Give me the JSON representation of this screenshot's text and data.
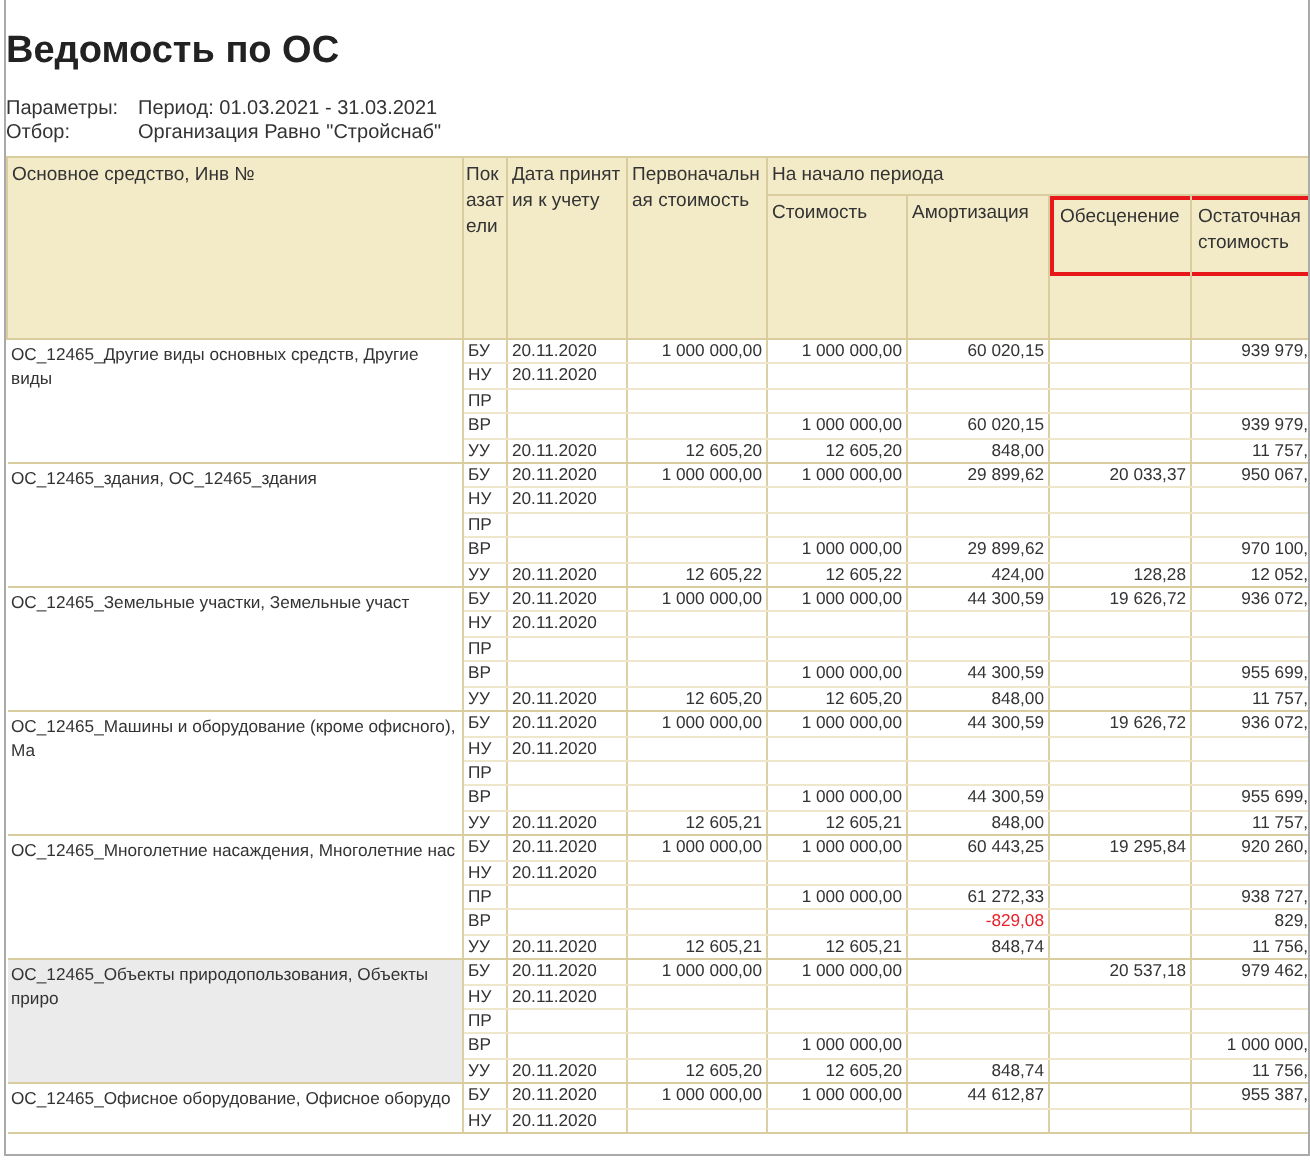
{
  "title": "Ведомость по ОС",
  "parameters": [
    {
      "label": "Параметры:",
      "value": "Период: 01.03.2021 - 31.03.2021"
    },
    {
      "label": "Отбор:",
      "value": "Организация Равно \"Стройснаб\""
    }
  ],
  "table": {
    "columns": [
      {
        "label": "Основное средство, Инв №"
      },
      {
        "label": "Показатели"
      },
      {
        "label": "Дата принятия к учету"
      },
      {
        "label": "Первоначальная стоимость"
      }
    ],
    "column_group": {
      "label": "На начало периода",
      "columns": [
        {
          "label": "Стоимость",
          "highlighted": false
        },
        {
          "label": "Амортизация",
          "highlighted": false
        },
        {
          "label": "Обесценение",
          "highlighted": true
        },
        {
          "label": "Остаточная стоимость",
          "highlighted": true
        }
      ]
    },
    "groups": [
      {
        "asset": "ОС_12465_Другие виды основных средств, Другие виды",
        "selected": false,
        "rows": [
          {
            "indicator": "БУ",
            "date": "20.11.2020",
            "initial": "1 000 000,00",
            "cost": "1 000 000,00",
            "amortization": "60 020,15",
            "negative": false,
            "residual": "939 979,"
          },
          {
            "indicator": "НУ",
            "date": "20.11.2020"
          },
          {
            "indicator": "ПР"
          },
          {
            "indicator": "ВР",
            "cost": "1 000 000,00",
            "amortization": "60 020,15",
            "negative": false,
            "residual": "939 979,"
          },
          {
            "indicator": "УУ",
            "date": "20.11.2020",
            "initial": "12 605,20",
            "cost": "12 605,20",
            "amortization": "848,00",
            "negative": false,
            "residual": "11 757,"
          }
        ]
      },
      {
        "asset": "ОС_12465_здания, ОС_12465_здания",
        "selected": false,
        "rows": [
          {
            "indicator": "БУ",
            "date": "20.11.2020",
            "initial": "1 000 000,00",
            "cost": "1 000 000,00",
            "amortization": "29 899,62",
            "negative": false,
            "impairment": "20 033,37",
            "residual": "950 067,"
          },
          {
            "indicator": "НУ",
            "date": "20.11.2020"
          },
          {
            "indicator": "ПР"
          },
          {
            "indicator": "ВР",
            "cost": "1 000 000,00",
            "amortization": "29 899,62",
            "negative": false,
            "residual": "970 100,"
          },
          {
            "indicator": "УУ",
            "date": "20.11.2020",
            "initial": "12 605,22",
            "cost": "12 605,22",
            "amortization": "424,00",
            "negative": false,
            "impairment": "128,28",
            "residual": "12 052,"
          }
        ]
      },
      {
        "asset": "ОС_12465_Земельные участки, Земельные участ",
        "selected": false,
        "rows": [
          {
            "indicator": "БУ",
            "date": "20.11.2020",
            "initial": "1 000 000,00",
            "cost": "1 000 000,00",
            "amortization": "44 300,59",
            "negative": false,
            "impairment": "19 626,72",
            "residual": "936 072,"
          },
          {
            "indicator": "НУ",
            "date": "20.11.2020"
          },
          {
            "indicator": "ПР"
          },
          {
            "indicator": "ВР",
            "cost": "1 000 000,00",
            "amortization": "44 300,59",
            "negative": false,
            "residual": "955 699,"
          },
          {
            "indicator": "УУ",
            "date": "20.11.2020",
            "initial": "12 605,20",
            "cost": "12 605,20",
            "amortization": "848,00",
            "negative": false,
            "residual": "11 757,"
          }
        ]
      },
      {
        "asset": "ОС_12465_Машины и оборудование (кроме офисного), Ма",
        "selected": false,
        "rows": [
          {
            "indicator": "БУ",
            "date": "20.11.2020",
            "initial": "1 000 000,00",
            "cost": "1 000 000,00",
            "amortization": "44 300,59",
            "negative": false,
            "impairment": "19 626,72",
            "residual": "936 072,"
          },
          {
            "indicator": "НУ",
            "date": "20.11.2020"
          },
          {
            "indicator": "ПР"
          },
          {
            "indicator": "ВР",
            "cost": "1 000 000,00",
            "amortization": "44 300,59",
            "negative": false,
            "residual": "955 699,"
          },
          {
            "indicator": "УУ",
            "date": "20.11.2020",
            "initial": "12 605,21",
            "cost": "12 605,21",
            "amortization": "848,00",
            "negative": false,
            "residual": "11 757,"
          }
        ]
      },
      {
        "asset": "ОС_12465_Многолетние насаждения, Многолетние нас",
        "selected": false,
        "rows": [
          {
            "indicator": "БУ",
            "date": "20.11.2020",
            "initial": "1 000 000,00",
            "cost": "1 000 000,00",
            "amortization": "60 443,25",
            "negative": false,
            "impairment": "19 295,84",
            "residual": "920 260,"
          },
          {
            "indicator": "НУ",
            "date": "20.11.2020"
          },
          {
            "indicator": "ПР",
            "cost": "1 000 000,00",
            "amortization": "61 272,33",
            "negative": false,
            "residual": "938 727,"
          },
          {
            "indicator": "ВР",
            "amortization": "-829,08",
            "negative": true,
            "residual": "829,"
          },
          {
            "indicator": "УУ",
            "date": "20.11.2020",
            "initial": "12 605,21",
            "cost": "12 605,21",
            "amortization": "848,74",
            "negative": false,
            "residual": "11 756,"
          }
        ]
      },
      {
        "asset": "ОС_12465_Объекты природопользования, Объекты приро",
        "selected": true,
        "rows": [
          {
            "indicator": "БУ",
            "date": "20.11.2020",
            "initial": "1 000 000,00",
            "cost": "1 000 000,00",
            "impairment": "20 537,18",
            "residual": "979 462,"
          },
          {
            "indicator": "НУ",
            "date": "20.11.2020"
          },
          {
            "indicator": "ПР"
          },
          {
            "indicator": "ВР",
            "cost": "1 000 000,00",
            "residual": "1 000 000,"
          },
          {
            "indicator": "УУ",
            "date": "20.11.2020",
            "initial": "12 605,20",
            "cost": "12 605,20",
            "amortization": "848,74",
            "negative": false,
            "residual": "11 756,"
          }
        ]
      },
      {
        "asset": "ОС_12465_Офисное оборудование, Офисное оборудо",
        "selected": false,
        "rows": [
          {
            "indicator": "БУ",
            "date": "20.11.2020",
            "initial": "1 000 000,00",
            "cost": "1 000 000,00",
            "amortization": "44 612,87",
            "negative": false,
            "residual": "955 387,"
          },
          {
            "indicator": "НУ",
            "date": "20.11.2020"
          }
        ]
      }
    ]
  }
}
